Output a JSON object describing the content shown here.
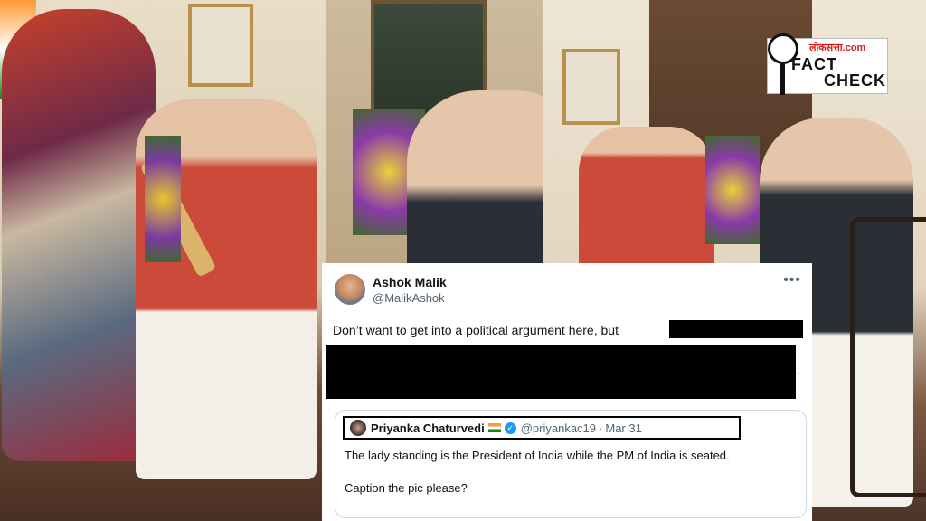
{
  "tweet": {
    "display_name": "Ashok Malik",
    "handle": "@MalikAshok",
    "text": "Don’t want to get into a political argument here, but",
    "trailing_dot": "."
  },
  "quoted_tweet": {
    "display_name": "Priyanka Chaturvedi",
    "handle": "@priyankac19",
    "separator": "·",
    "date": "Mar 31",
    "line1": "The lady standing is the President of India while the PM of India is seated.",
    "line2": "Caption the pic please?"
  },
  "badge": {
    "site": "लोकसत्ता.com",
    "fact": "FACT",
    "check": "CHECK"
  },
  "colors": {
    "verified": "#1d9bf0",
    "badge_site": "#d11a1a"
  },
  "icons": [
    "more-icon",
    "verified-icon",
    "flag-icon",
    "magnifier-icon"
  ]
}
